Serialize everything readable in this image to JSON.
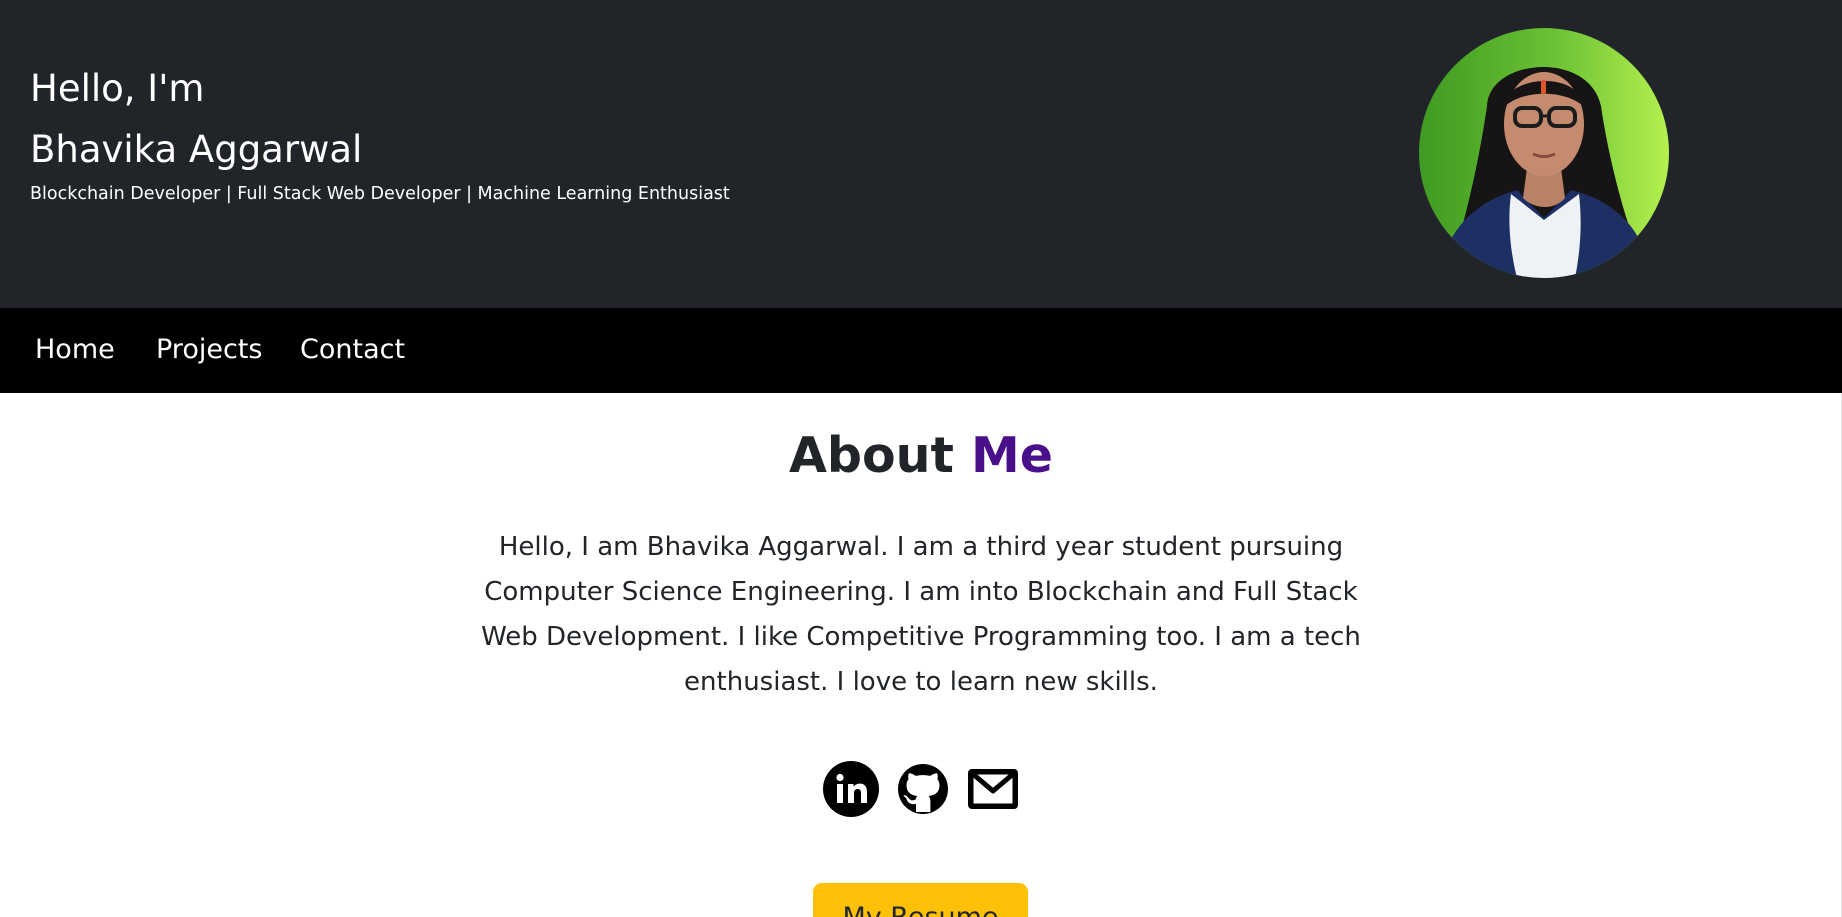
{
  "hero": {
    "greeting": "Hello, I'm",
    "name": "Bhavika Aggarwal",
    "tagline": "Blockchain Developer | Full Stack Web Developer | Machine Learning Enthusiast"
  },
  "nav": {
    "items": [
      {
        "label": "Home"
      },
      {
        "label": "Projects"
      },
      {
        "label": "Contact"
      }
    ]
  },
  "about": {
    "title_prefix": "About",
    "title_accent": "Me",
    "body": "Hello, I am Bhavika Aggarwal. I am a third year student pursuing Computer Science Engineering. I am into Blockchain and Full Stack Web Development. I like Competitive Programming too. I am a tech enthusiast. I love to learn new skills."
  },
  "socials": [
    {
      "icon": "linkedin-icon"
    },
    {
      "icon": "github-icon"
    },
    {
      "icon": "mail-icon"
    }
  ],
  "resume": {
    "label": "My Resume"
  },
  "colors": {
    "hero_bg": "#212529",
    "nav_bg": "#000000",
    "accent": "#4a0f8a",
    "button": "#ffc107"
  }
}
